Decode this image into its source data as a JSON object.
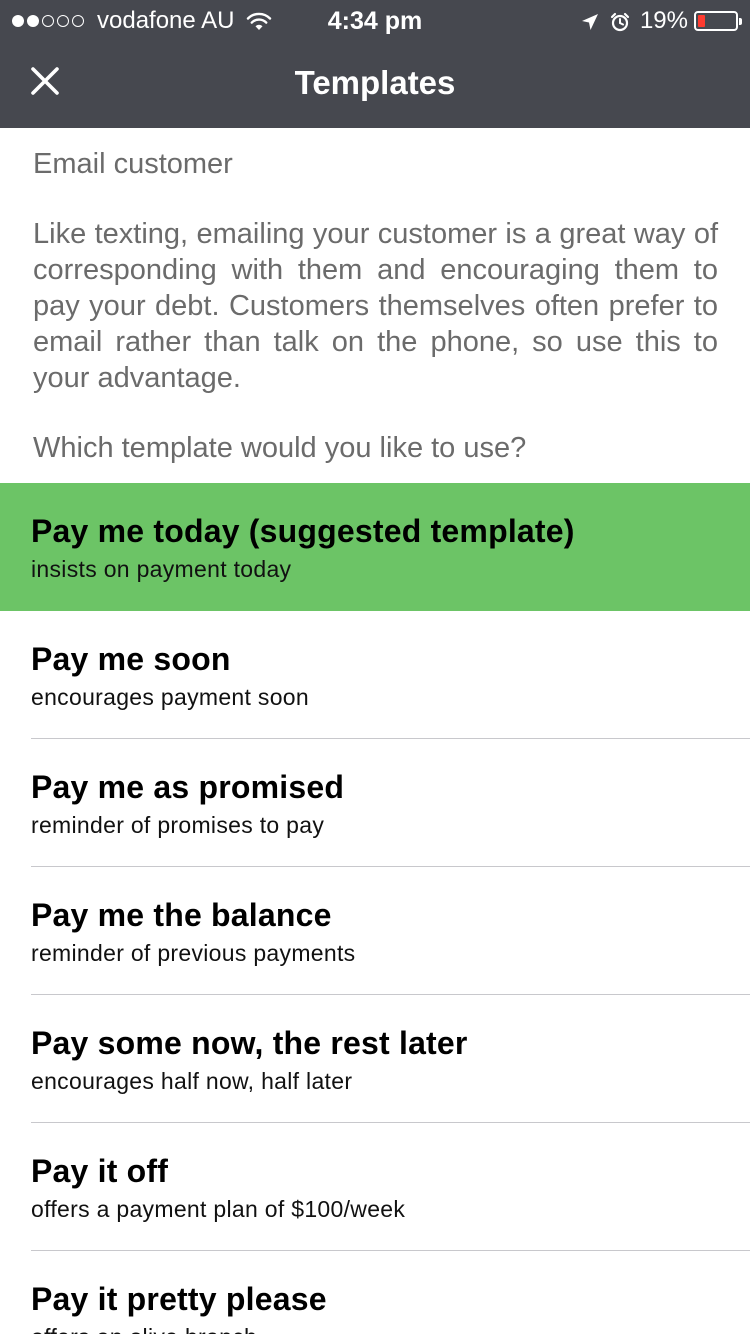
{
  "status_bar": {
    "carrier": "vodafone AU",
    "time": "4:34 pm",
    "battery_percent": "19%",
    "battery_level": 0.19,
    "signal_bars_filled": 2,
    "signal_bars_total": 5,
    "icons": [
      "signal-dots-icon",
      "wifi-icon",
      "location-arrow-icon",
      "alarm-clock-icon",
      "battery-icon"
    ],
    "battery_color": "#ff3b30"
  },
  "nav": {
    "title": "Templates",
    "close_icon": "close-icon"
  },
  "intro": {
    "heading": "Email customer",
    "description": "Like texting, emailing your customer is a great way of corresponding with them and encouraging them to pay your debt. Customers themselves often prefer to email rather than talk on the phone, so use this to your advantage.",
    "question": "Which template would you like to use?"
  },
  "templates": [
    {
      "title": "Pay me today (suggested template)",
      "subtitle": "insists on payment today",
      "selected": true
    },
    {
      "title": "Pay me soon",
      "subtitle": "encourages payment soon",
      "selected": false
    },
    {
      "title": "Pay me as promised",
      "subtitle": "reminder of promises to pay",
      "selected": false
    },
    {
      "title": "Pay me the balance",
      "subtitle": "reminder of previous payments",
      "selected": false
    },
    {
      "title": "Pay some now, the rest later",
      "subtitle": "encourages half now, half later",
      "selected": false
    },
    {
      "title": "Pay it off",
      "subtitle": "offers a payment plan of $100/week",
      "selected": false
    },
    {
      "title": "Pay it pretty please",
      "subtitle": "offers an olive branch",
      "selected": false
    }
  ],
  "colors": {
    "header_bg": "#46484f",
    "selected_bg": "#6cc466",
    "intro_text": "#6b6b6b"
  }
}
